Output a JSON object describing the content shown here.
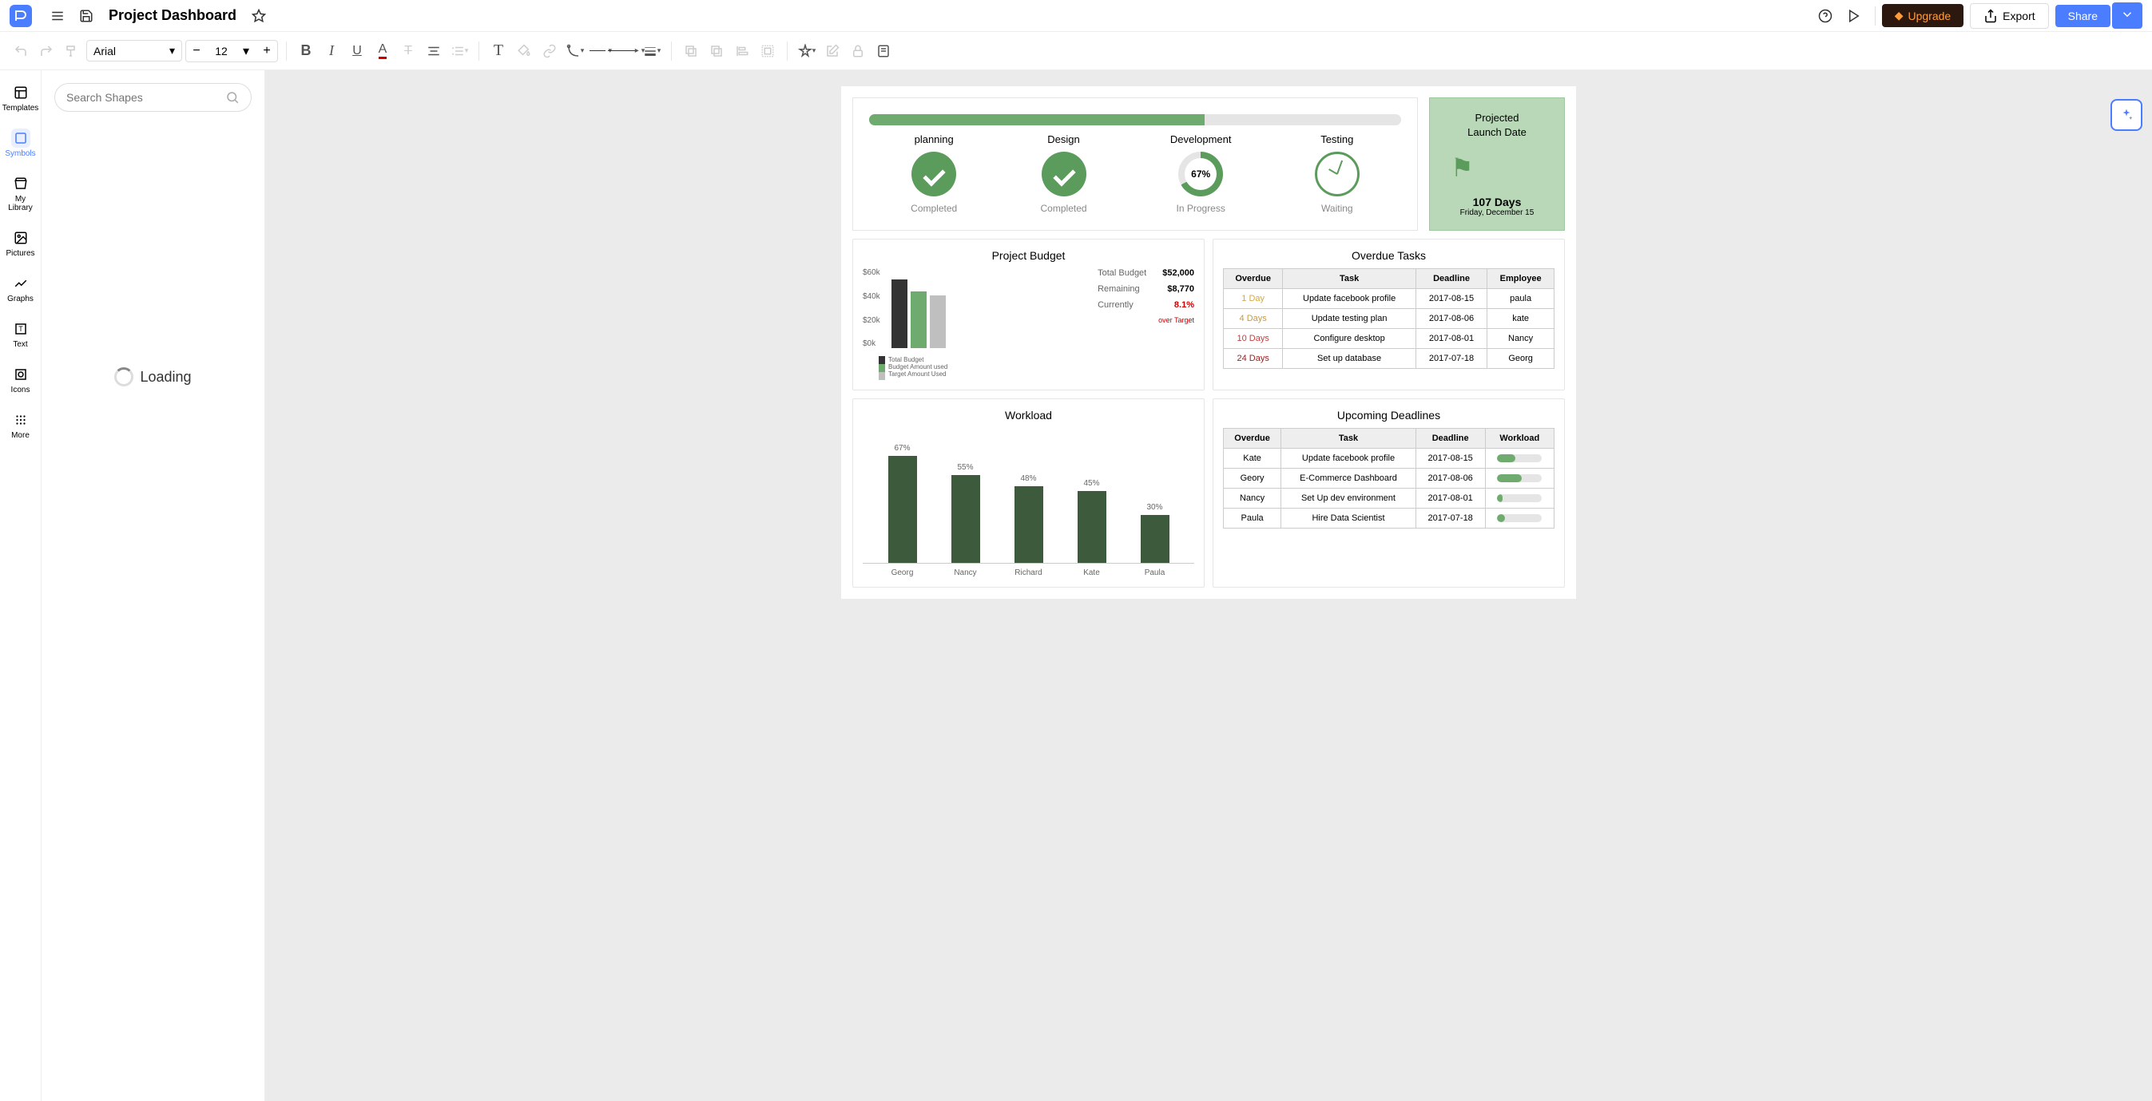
{
  "header": {
    "title": "Project Dashboard",
    "upgrade": "Upgrade",
    "export": "Export",
    "share": "Share"
  },
  "toolbar": {
    "font": "Arial",
    "size": "12"
  },
  "sidebar": {
    "items": [
      {
        "label": "Templates"
      },
      {
        "label": "Symbols"
      },
      {
        "label": "My Library"
      },
      {
        "label": "Pictures"
      },
      {
        "label": "Graphs"
      },
      {
        "label": "Text"
      },
      {
        "label": "Icons"
      },
      {
        "label": "More"
      }
    ]
  },
  "shapes_panel": {
    "search_placeholder": "Search Shapes",
    "loading": "Loading"
  },
  "dashboard": {
    "progress_pct": 63,
    "phases": [
      {
        "name": "planning",
        "status": "Completed",
        "type": "check"
      },
      {
        "name": "Design",
        "status": "Completed",
        "type": "check"
      },
      {
        "name": "Development",
        "status": "In Progress",
        "type": "ring",
        "pct": "67%"
      },
      {
        "name": "Testing",
        "status": "Waiting",
        "type": "clock"
      }
    ],
    "launch": {
      "title1": "Projected",
      "title2": "Launch Date",
      "days": "107 Days",
      "date": "Friday, December 15"
    },
    "budget": {
      "title": "Project Budget",
      "stats": [
        {
          "label": "Total Budget",
          "value": "$52,000"
        },
        {
          "label": "Remaining",
          "value": "$8,770"
        },
        {
          "label": "Currently",
          "value": "8.1%",
          "over": "over Target"
        }
      ],
      "legend": [
        "Total Budget",
        "Budget Amount used",
        "Target Amount Used"
      ]
    },
    "overdue": {
      "title": "Overdue Tasks",
      "headers": [
        "Overdue",
        "Task",
        "Deadline",
        "Employee"
      ],
      "rows": [
        {
          "overdue": "1 Day",
          "cls": "overdue-1",
          "task": "Update facebook profile",
          "deadline": "2017-08-15",
          "employee": "paula"
        },
        {
          "overdue": "4 Days",
          "cls": "overdue-4",
          "task": "Update testing plan",
          "deadline": "2017-08-06",
          "employee": "kate"
        },
        {
          "overdue": "10 Days",
          "cls": "overdue-10",
          "task": "Configure desktop",
          "deadline": "2017-08-01",
          "employee": "Nancy"
        },
        {
          "overdue": "24 Days",
          "cls": "overdue-24",
          "task": "Set up database",
          "deadline": "2017-07-18",
          "employee": "Georg"
        }
      ]
    },
    "workload": {
      "title": "Workload"
    },
    "upcoming": {
      "title": "Upcoming Deadlines",
      "headers": [
        "Overdue",
        "Task",
        "Deadline",
        "Workload"
      ],
      "rows": [
        {
          "who": "Kate",
          "task": "Update facebook profile",
          "deadline": "2017-08-15",
          "pct": 40
        },
        {
          "who": "Geory",
          "task": "E-Commerce Dashboard",
          "deadline": "2017-08-06",
          "pct": 55
        },
        {
          "who": "Nancy",
          "task": "Set Up dev environment",
          "deadline": "2017-08-01",
          "pct": 12
        },
        {
          "who": "Paula",
          "task": "Hire Data Scientist",
          "deadline": "2017-07-18",
          "pct": 18
        }
      ]
    }
  },
  "chart_data": [
    {
      "type": "bar",
      "title": "Project Budget",
      "ylabel": "$k",
      "ylim": [
        0,
        60
      ],
      "yticks": [
        "$60k",
        "$40k",
        "$20k",
        "$0k"
      ],
      "series": [
        {
          "name": "Total Budget",
          "values": [
            52
          ],
          "color": "#333333"
        },
        {
          "name": "Budget Amount used",
          "values": [
            43
          ],
          "color": "#6fab6f"
        },
        {
          "name": "Target Amount Used",
          "values": [
            40
          ],
          "color": "#bfbfbf"
        }
      ]
    },
    {
      "type": "bar",
      "title": "Workload",
      "categories": [
        "Georg",
        "Nancy",
        "Richard",
        "Kate",
        "Paula"
      ],
      "values": [
        67,
        55,
        48,
        45,
        30
      ],
      "value_suffix": "%",
      "color": "#3d5a3d"
    }
  ]
}
